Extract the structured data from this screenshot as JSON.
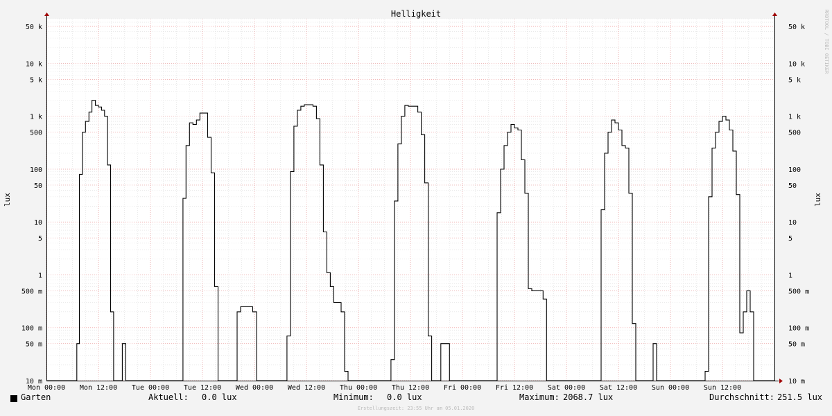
{
  "chart_data": {
    "type": "line",
    "title": "Helligkeit",
    "ylabel": "lux",
    "yscale": "log",
    "ylim": [
      0.01,
      70000
    ],
    "y_ticks": [
      {
        "v": 0.01,
        "label": "10 m"
      },
      {
        "v": 0.05,
        "label": "50 m"
      },
      {
        "v": 0.1,
        "label": "100 m"
      },
      {
        "v": 0.5,
        "label": "500 m"
      },
      {
        "v": 1,
        "label": "1"
      },
      {
        "v": 5,
        "label": "5"
      },
      {
        "v": 10,
        "label": "10"
      },
      {
        "v": 50,
        "label": "50"
      },
      {
        "v": 100,
        "label": "100"
      },
      {
        "v": 500,
        "label": "500"
      },
      {
        "v": 1000,
        "label": "1 k"
      },
      {
        "v": 5000,
        "label": "5 k"
      },
      {
        "v": 10000,
        "label": "10 k"
      },
      {
        "v": 50000,
        "label": "50 k"
      }
    ],
    "x_unit": "hours",
    "xlim": [
      0,
      168
    ],
    "x_ticks": [
      {
        "h": 0,
        "label": "Mon 00:00"
      },
      {
        "h": 12,
        "label": "Mon 12:00"
      },
      {
        "h": 24,
        "label": "Tue 00:00"
      },
      {
        "h": 36,
        "label": "Tue 12:00"
      },
      {
        "h": 48,
        "label": "Wed 00:00"
      },
      {
        "h": 60,
        "label": "Wed 12:00"
      },
      {
        "h": 72,
        "label": "Thu 00:00"
      },
      {
        "h": 84,
        "label": "Thu 12:00"
      },
      {
        "h": 96,
        "label": "Fri 00:00"
      },
      {
        "h": 108,
        "label": "Fri 12:00"
      },
      {
        "h": 120,
        "label": "Sat 00:00"
      },
      {
        "h": 132,
        "label": "Sat 12:00"
      },
      {
        "h": 144,
        "label": "Sun 00:00"
      },
      {
        "h": 156,
        "label": "Sun 12:00"
      }
    ],
    "grid": true,
    "series": [
      {
        "name": "Garten",
        "color": "#000000",
        "points": [
          [
            0.0,
            0.01
          ],
          [
            7.0,
            0.01
          ],
          [
            7.0,
            0.05
          ],
          [
            7.6,
            0.05
          ],
          [
            7.6,
            80
          ],
          [
            8.3,
            80
          ],
          [
            8.3,
            500
          ],
          [
            9.0,
            500
          ],
          [
            9.0,
            800
          ],
          [
            9.8,
            800
          ],
          [
            9.8,
            1200
          ],
          [
            10.5,
            1200
          ],
          [
            10.5,
            2000
          ],
          [
            11.3,
            2000
          ],
          [
            11.3,
            1600
          ],
          [
            12.0,
            1600
          ],
          [
            12.0,
            1500
          ],
          [
            12.7,
            1500
          ],
          [
            12.7,
            1300
          ],
          [
            13.4,
            1300
          ],
          [
            13.4,
            1000
          ],
          [
            14.1,
            1000
          ],
          [
            14.1,
            120
          ],
          [
            14.8,
            120
          ],
          [
            14.8,
            0.2
          ],
          [
            15.5,
            0.2
          ],
          [
            15.5,
            0.01
          ],
          [
            17.5,
            0.01
          ],
          [
            17.5,
            0.05
          ],
          [
            18.3,
            0.05
          ],
          [
            18.3,
            0.01
          ],
          [
            31.5,
            0.01
          ],
          [
            31.5,
            28
          ],
          [
            32.2,
            28
          ],
          [
            32.2,
            280
          ],
          [
            33.0,
            280
          ],
          [
            33.0,
            750
          ],
          [
            33.8,
            750
          ],
          [
            33.8,
            700
          ],
          [
            34.6,
            700
          ],
          [
            34.6,
            850
          ],
          [
            35.4,
            850
          ],
          [
            35.4,
            1150
          ],
          [
            37.2,
            1150
          ],
          [
            37.2,
            400
          ],
          [
            38.0,
            400
          ],
          [
            38.0,
            85
          ],
          [
            38.8,
            85
          ],
          [
            38.8,
            0.6
          ],
          [
            39.6,
            0.6
          ],
          [
            39.6,
            0.01
          ],
          [
            44.0,
            0.01
          ],
          [
            44.0,
            0.2
          ],
          [
            44.8,
            0.2
          ],
          [
            44.8,
            0.25
          ],
          [
            47.6,
            0.25
          ],
          [
            47.6,
            0.2
          ],
          [
            48.5,
            0.2
          ],
          [
            48.5,
            0.01
          ],
          [
            55.5,
            0.01
          ],
          [
            55.5,
            0.07
          ],
          [
            56.3,
            0.07
          ],
          [
            56.3,
            90
          ],
          [
            57.1,
            90
          ],
          [
            57.1,
            650
          ],
          [
            57.9,
            650
          ],
          [
            57.9,
            1300
          ],
          [
            58.7,
            1300
          ],
          [
            58.7,
            1550
          ],
          [
            59.5,
            1550
          ],
          [
            59.5,
            1650
          ],
          [
            61.5,
            1650
          ],
          [
            61.5,
            1550
          ],
          [
            62.3,
            1550
          ],
          [
            62.3,
            900
          ],
          [
            63.1,
            900
          ],
          [
            63.1,
            120
          ],
          [
            63.9,
            120
          ],
          [
            63.9,
            6.5
          ],
          [
            64.7,
            6.5
          ],
          [
            64.7,
            1.1
          ],
          [
            65.5,
            1.1
          ],
          [
            65.5,
            0.6
          ],
          [
            66.3,
            0.6
          ],
          [
            66.3,
            0.3
          ],
          [
            68.0,
            0.3
          ],
          [
            68.0,
            0.2
          ],
          [
            68.8,
            0.2
          ],
          [
            68.8,
            0.015
          ],
          [
            69.6,
            0.015
          ],
          [
            69.6,
            0.01
          ],
          [
            79.5,
            0.01
          ],
          [
            79.5,
            0.025
          ],
          [
            80.3,
            0.025
          ],
          [
            80.3,
            25
          ],
          [
            81.1,
            25
          ],
          [
            81.1,
            300
          ],
          [
            81.9,
            300
          ],
          [
            81.9,
            1000
          ],
          [
            82.7,
            1000
          ],
          [
            82.7,
            1600
          ],
          [
            83.5,
            1600
          ],
          [
            83.5,
            1550
          ],
          [
            85.7,
            1550
          ],
          [
            85.7,
            1200
          ],
          [
            86.5,
            1200
          ],
          [
            86.5,
            450
          ],
          [
            87.3,
            450
          ],
          [
            87.3,
            55
          ],
          [
            88.1,
            55
          ],
          [
            88.1,
            0.07
          ],
          [
            88.9,
            0.07
          ],
          [
            88.9,
            0.01
          ],
          [
            91.0,
            0.01
          ],
          [
            91.0,
            0.05
          ],
          [
            93.0,
            0.05
          ],
          [
            93.0,
            0.01
          ],
          [
            104.0,
            0.01
          ],
          [
            104.0,
            15
          ],
          [
            104.8,
            15
          ],
          [
            104.8,
            100
          ],
          [
            105.6,
            100
          ],
          [
            105.6,
            280
          ],
          [
            106.4,
            280
          ],
          [
            106.4,
            500
          ],
          [
            107.2,
            500
          ],
          [
            107.2,
            700
          ],
          [
            108.0,
            700
          ],
          [
            108.0,
            600
          ],
          [
            108.8,
            600
          ],
          [
            108.8,
            550
          ],
          [
            109.6,
            550
          ],
          [
            109.6,
            150
          ],
          [
            110.4,
            150
          ],
          [
            110.4,
            35
          ],
          [
            111.2,
            35
          ],
          [
            111.2,
            0.55
          ],
          [
            112.0,
            0.55
          ],
          [
            112.0,
            0.5
          ],
          [
            114.6,
            0.5
          ],
          [
            114.6,
            0.35
          ],
          [
            115.4,
            0.35
          ],
          [
            115.4,
            0.01
          ],
          [
            128.0,
            0.01
          ],
          [
            128.0,
            17
          ],
          [
            128.8,
            17
          ],
          [
            128.8,
            200
          ],
          [
            129.6,
            200
          ],
          [
            129.6,
            500
          ],
          [
            130.4,
            500
          ],
          [
            130.4,
            850
          ],
          [
            131.2,
            850
          ],
          [
            131.2,
            750
          ],
          [
            132.0,
            750
          ],
          [
            132.0,
            550
          ],
          [
            132.8,
            550
          ],
          [
            132.8,
            280
          ],
          [
            133.6,
            280
          ],
          [
            133.6,
            250
          ],
          [
            134.4,
            250
          ],
          [
            134.4,
            35
          ],
          [
            135.2,
            35
          ],
          [
            135.2,
            0.12
          ],
          [
            136.0,
            0.12
          ],
          [
            136.0,
            0.01
          ],
          [
            140.0,
            0.01
          ],
          [
            140.0,
            0.05
          ],
          [
            140.8,
            0.05
          ],
          [
            140.8,
            0.01
          ],
          [
            152.0,
            0.01
          ],
          [
            152.0,
            0.015
          ],
          [
            152.8,
            0.015
          ],
          [
            152.8,
            30
          ],
          [
            153.6,
            30
          ],
          [
            153.6,
            250
          ],
          [
            154.4,
            250
          ],
          [
            154.4,
            500
          ],
          [
            155.2,
            500
          ],
          [
            155.2,
            800
          ],
          [
            156.0,
            800
          ],
          [
            156.0,
            1000
          ],
          [
            156.8,
            1000
          ],
          [
            156.8,
            850
          ],
          [
            157.6,
            850
          ],
          [
            157.6,
            550
          ],
          [
            158.4,
            550
          ],
          [
            158.4,
            220
          ],
          [
            159.2,
            220
          ],
          [
            159.2,
            33
          ],
          [
            160.0,
            33
          ],
          [
            160.0,
            0.08
          ],
          [
            160.8,
            0.08
          ],
          [
            160.8,
            0.2
          ],
          [
            161.6,
            0.2
          ],
          [
            161.6,
            0.5
          ],
          [
            162.4,
            0.5
          ],
          [
            162.4,
            0.2
          ],
          [
            163.2,
            0.2
          ],
          [
            163.2,
            0.01
          ],
          [
            168.0,
            0.01
          ]
        ]
      }
    ]
  },
  "legend": {
    "series_name": "Garten",
    "aktuell_label": "Aktuell:",
    "aktuell_value": "0.0 lux",
    "minimum_label": "Minimum:",
    "minimum_value": "0.0 lux",
    "maximum_label": "Maximum:",
    "maximum_value": "2068.7 lux",
    "durchschnitt_label": "Durchschnitt:",
    "durchschnitt_value": "251.5 lux"
  },
  "watermark": "RRDTOOL / TOBI OETIKER",
  "footer_text": "Erstellungszeit: 23:55 Uhr am 05.01.2020",
  "colors": {
    "background": "#f3f3f3",
    "canvas": "#ffffff",
    "minor_grid": "#dddddd",
    "major_grid": "#f0a0a0",
    "axis_arrow": "#a00000",
    "line": "#000000"
  }
}
